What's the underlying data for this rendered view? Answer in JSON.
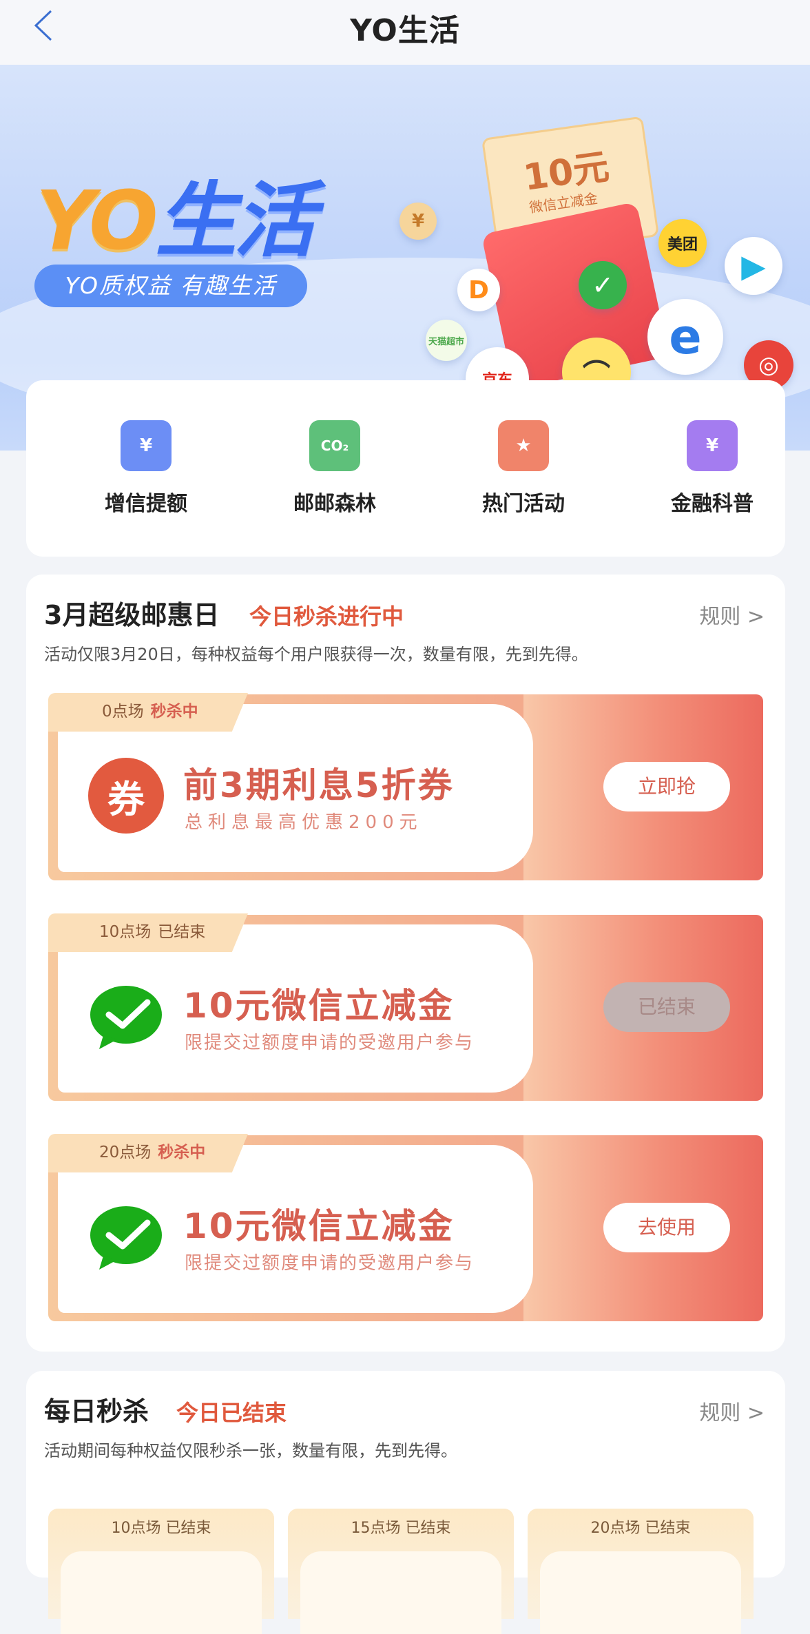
{
  "header": {
    "title": "YO生活"
  },
  "banner": {
    "brand_yo": "YO",
    "brand_life": "生活",
    "slogan": "YO质权益 有趣生活",
    "ticket_amount": "10元",
    "ticket_sub": "微信立减金",
    "partners": {
      "meituan": "美团",
      "jd": "京东",
      "tmall": "天猫超市"
    }
  },
  "quick": [
    {
      "label": "增信提额",
      "icon": "wallet-yuan-icon",
      "color": "#6c8ef5",
      "glyph": "¥"
    },
    {
      "label": "邮邮森林",
      "icon": "co2-cloud-icon",
      "color": "#5ec07a",
      "glyph": "CO₂"
    },
    {
      "label": "热门活动",
      "icon": "star-bookmark-icon",
      "color": "#f0846a",
      "glyph": "★"
    },
    {
      "label": "金融科普",
      "icon": "finance-search-icon",
      "color": "#a47cf0",
      "glyph": "¥"
    }
  ],
  "section1": {
    "title": "3月超级邮惠日",
    "status": "今日秒杀进行中",
    "rule": "规则 >",
    "desc": "活动仅限3月20日，每种权益每个用户限获得一次，数量有限，先到先得。",
    "cards": [
      {
        "session": "0点场",
        "state": "秒杀中",
        "title": "前3期利息5折券",
        "sub": "总利息最高优惠200元",
        "button": "立即抢",
        "icon": "coupon-icon",
        "glyph": "券"
      },
      {
        "session": "10点场",
        "state": "已结束",
        "title": "10元微信立减金",
        "sub": "限提交过额度申请的受邀用户参与",
        "button": "已结束",
        "icon": "wechat-icon",
        "glyph": ""
      },
      {
        "session": "20点场",
        "state": "秒杀中",
        "title": "10元微信立减金",
        "sub": "限提交过额度申请的受邀用户参与",
        "button": "去使用",
        "icon": "wechat-icon",
        "glyph": ""
      }
    ]
  },
  "section2": {
    "title": "每日秒杀",
    "status": "今日已结束",
    "rule": "规则 >",
    "desc": "活动期间每种权益仅限秒杀一张，数量有限，先到先得。",
    "sessions": [
      "10点场 已结束",
      "15点场 已结束",
      "20点场 已结束"
    ]
  },
  "colors": {
    "accent": "#e0593d",
    "wechat": "#1aad19"
  }
}
